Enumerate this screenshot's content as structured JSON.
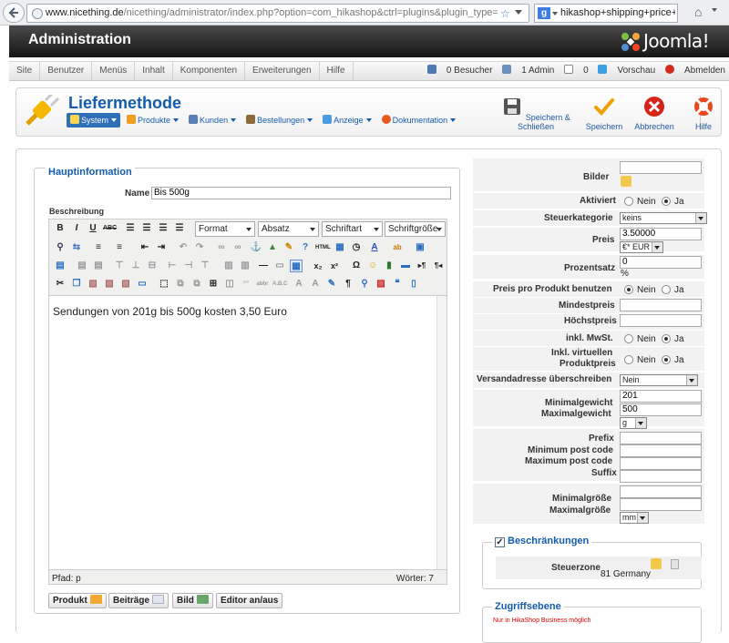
{
  "browser": {
    "url_host": "www.nicething.de",
    "url_path": "/nicething/administrator/index.php?option=com_hikashop&ctrl=plugins&plugin_type=shippin",
    "search_text": "hikashop+shipping+price+p"
  },
  "header": {
    "title": "Administration",
    "logo_text": "Joomla!"
  },
  "menu": {
    "items": [
      "Site",
      "Benutzer",
      "Menüs",
      "Inhalt",
      "Komponenten",
      "Erweiterungen",
      "Hilfe"
    ],
    "status": {
      "visitors": "0 Besucher",
      "admins": "1 Admin",
      "messages": "0",
      "preview": "Vorschau",
      "logout": "Abmelden"
    }
  },
  "toolbar": {
    "title": "Liefermethode",
    "submenu": [
      "System",
      "Produkte",
      "Kunden",
      "Bestellungen",
      "Anzeige",
      "Dokumentation"
    ],
    "buttons": {
      "save_close": "Speichern & Schließen",
      "save": "Speichern",
      "cancel": "Abbrechen",
      "help": "Hilfe"
    }
  },
  "main": {
    "legend": "Hauptinformation",
    "name_label": "Name",
    "name_value": "Bis 500g",
    "desc_label": "Beschreibung",
    "editor": {
      "format": "Format",
      "paragraph": "Absatz",
      "font": "Schriftart",
      "size": "Schriftgröße",
      "content": "Sendungen von 201g bis 500g kosten 3,50 Euro",
      "path": "Pfad: p",
      "words": "Wörter: 7"
    },
    "buttons": {
      "product": "Produkt",
      "articles": "Beiträge",
      "image": "Bild",
      "toggle": "Editor an/aus"
    }
  },
  "right": {
    "images": "Bilder",
    "active": "Aktiviert",
    "no": "Nein",
    "yes": "Ja",
    "tax_category": "Steuerkategorie",
    "tax_value": "keins",
    "price": "Preis",
    "price_value": "3.50000",
    "currency": "€* EUR",
    "percent": "Prozentsatz",
    "percent_value": "0",
    "percent_unit": "%",
    "price_per_product": "Preis pro Produkt benutzen",
    "min_price": "Mindestpreis",
    "max_price": "Höchstpreis",
    "incl_vat": "inkl. MwSt.",
    "incl_virtual_1": "Inkl. virtuellen",
    "incl_virtual_2": "Produktpreis",
    "override_addr": "Versandadresse überschreiben",
    "override_value": "Nein",
    "min_weight": "Minimalgewicht",
    "max_weight": "Maximalgewicht",
    "min_weight_value": "201",
    "max_weight_value": "500",
    "weight_unit": "g",
    "prefix": "Prefix",
    "min_post": "Minimum post code",
    "max_post": "Maximum post code",
    "suffix": "Suffix",
    "min_size": "Minimalgröße",
    "max_size": "Maximalgröße",
    "size_unit": "mm"
  },
  "restrictions": {
    "legend": "Beschränkungen",
    "tax_zone": "Steuerzone",
    "zone_value": "81 Germany"
  },
  "access": {
    "legend": "Zugriffsebene",
    "note": "Nur in HikaShop Business möglich"
  }
}
